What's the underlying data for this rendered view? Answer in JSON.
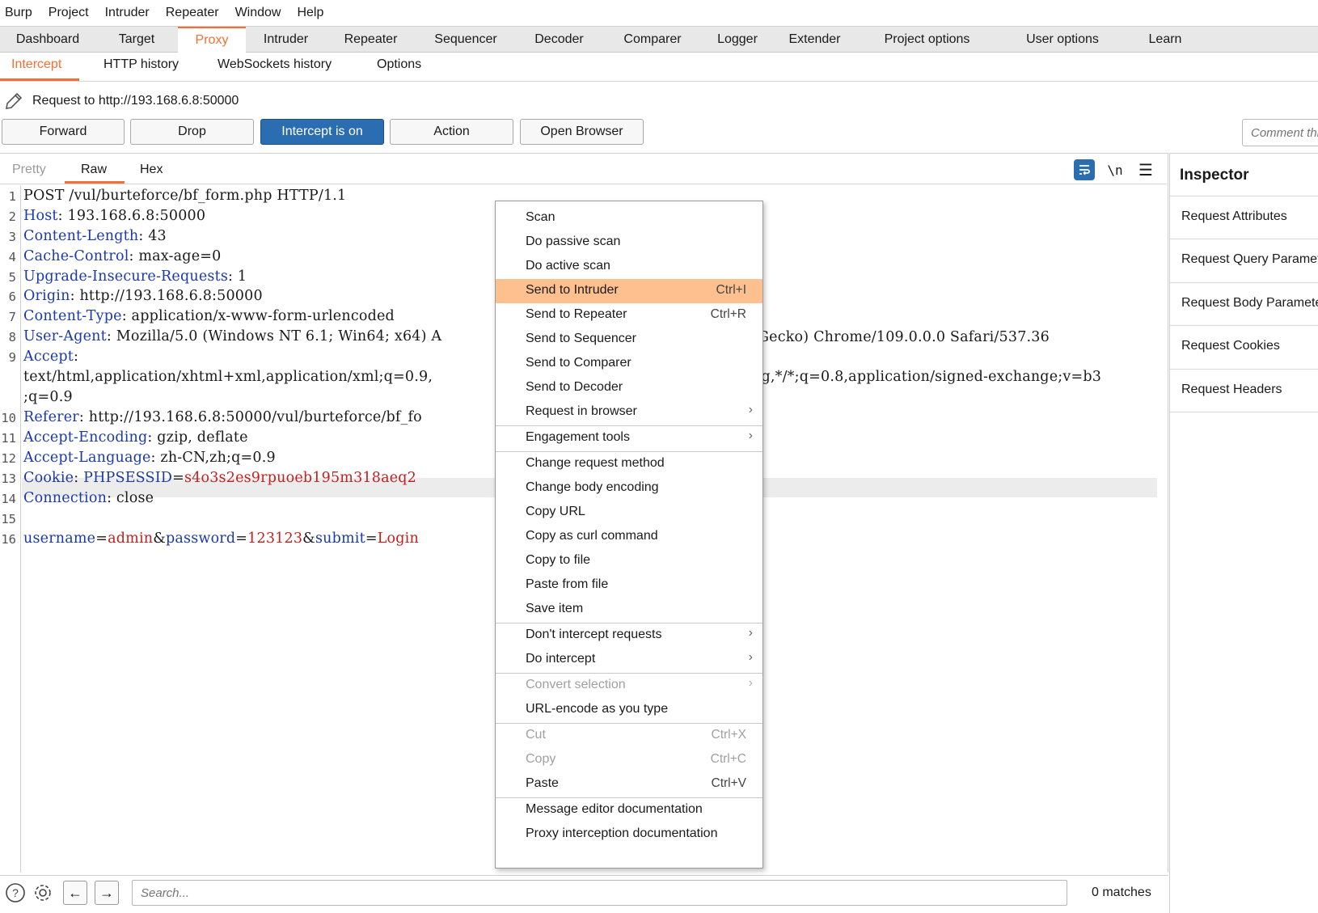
{
  "menubar": [
    "Burp",
    "Project",
    "Intruder",
    "Repeater",
    "Window",
    "Help"
  ],
  "main_tabs": [
    "Dashboard",
    "Target",
    "Proxy",
    "Intruder",
    "Repeater",
    "Sequencer",
    "Decoder",
    "Comparer",
    "Logger",
    "Extender",
    "Project options",
    "User options",
    "Learn"
  ],
  "active_main_tab": "Proxy",
  "sub_tabs": [
    "Intercept",
    "HTTP history",
    "WebSockets history",
    "Options"
  ],
  "active_sub_tab": "Intercept",
  "request_to": "Request to http://193.168.6.8:50000",
  "buttons": {
    "forward": "Forward",
    "drop": "Drop",
    "intercept": "Intercept is on",
    "action": "Action",
    "open_browser": "Open Browser"
  },
  "comment_placeholder": "Comment this item",
  "editor_tabs": [
    "Pretty",
    "Raw",
    "Hex"
  ],
  "active_editor_tab": "Raw",
  "newline_icon_label": "\\n",
  "code_lines": [
    {
      "n": "1",
      "parts": [
        {
          "t": "POST /vul/burteforce/bf_form.php HTTP/1.1",
          "c": ""
        }
      ]
    },
    {
      "n": "2",
      "parts": [
        {
          "t": "Host",
          "c": "k"
        },
        {
          "t": ": 193.168.6.8:50000",
          "c": ""
        }
      ]
    },
    {
      "n": "3",
      "parts": [
        {
          "t": "Content-Length",
          "c": "k"
        },
        {
          "t": ": 43",
          "c": ""
        }
      ]
    },
    {
      "n": "4",
      "parts": [
        {
          "t": "Cache-Control",
          "c": "k"
        },
        {
          "t": ": max-age=0",
          "c": ""
        }
      ]
    },
    {
      "n": "5",
      "parts": [
        {
          "t": "Upgrade-Insecure-Requests",
          "c": "k"
        },
        {
          "t": ": 1",
          "c": ""
        }
      ]
    },
    {
      "n": "6",
      "parts": [
        {
          "t": "Origin",
          "c": "k"
        },
        {
          "t": ": http://193.168.6.8:50000",
          "c": ""
        }
      ]
    },
    {
      "n": "7",
      "parts": [
        {
          "t": "Content-Type",
          "c": "k"
        },
        {
          "t": ": application/x-www-form-urlencoded",
          "c": ""
        }
      ]
    },
    {
      "n": "8",
      "parts": [
        {
          "t": "User-Agent",
          "c": "k"
        },
        {
          "t": ": Mozilla/5.0 (Windows NT 6.1; Win64; x64) A",
          "c": ""
        }
      ]
    },
    {
      "n": "9",
      "parts": [
        {
          "t": "Accept",
          "c": "k"
        },
        {
          "t": ":",
          "c": ""
        }
      ]
    },
    {
      "n": "",
      "parts": [
        {
          "t": "text/html,application/xhtml+xml,application/xml;q=0.9,",
          "c": ""
        }
      ]
    },
    {
      "n": "",
      "parts": [
        {
          "t": ";q=0.9",
          "c": ""
        }
      ]
    },
    {
      "n": "10",
      "parts": [
        {
          "t": "Referer",
          "c": "k"
        },
        {
          "t": ": http://193.168.6.8:50000/vul/burteforce/bf_fo",
          "c": ""
        }
      ]
    },
    {
      "n": "11",
      "parts": [
        {
          "t": "Accept-Encoding",
          "c": "k"
        },
        {
          "t": ": gzip, deflate",
          "c": ""
        }
      ]
    },
    {
      "n": "12",
      "parts": [
        {
          "t": "Accept-Language",
          "c": "k"
        },
        {
          "t": ": zh-CN,zh;q=0.9",
          "c": ""
        }
      ]
    },
    {
      "n": "13",
      "parts": [
        {
          "t": "Cookie",
          "c": "k"
        },
        {
          "t": ": ",
          "c": ""
        },
        {
          "t": "PHPSESSID",
          "c": "k"
        },
        {
          "t": "=",
          "c": ""
        },
        {
          "t": "s4o3s2es9rpuoeb195m318aeq2",
          "c": "v"
        }
      ]
    },
    {
      "n": "14",
      "parts": [
        {
          "t": "Connection",
          "c": "k"
        },
        {
          "t": ": close",
          "c": ""
        }
      ]
    },
    {
      "n": "15",
      "parts": []
    },
    {
      "n": "16",
      "parts": [
        {
          "t": "username",
          "c": "k"
        },
        {
          "t": "=",
          "c": ""
        },
        {
          "t": "admin",
          "c": "v"
        },
        {
          "t": "&",
          "c": ""
        },
        {
          "t": "password",
          "c": "k"
        },
        {
          "t": "=",
          "c": ""
        },
        {
          "t": "123123",
          "c": "v"
        },
        {
          "t": "&",
          "c": ""
        },
        {
          "t": "submit",
          "c": "k"
        },
        {
          "t": "=",
          "c": ""
        },
        {
          "t": "Login",
          "c": "v"
        }
      ]
    }
  ],
  "overflow_text": {
    "line8_tail": "Gecko) Chrome/109.0.0.0 Safari/537.36",
    "line9_tail": "ng,*/*;q=0.8,application/signed-exchange;v=b3"
  },
  "context_menu": [
    {
      "label": "Scan"
    },
    {
      "label": "Do passive scan"
    },
    {
      "label": "Do active scan"
    },
    {
      "label": "Send to Intruder",
      "shortcut": "Ctrl+I",
      "highlight": true
    },
    {
      "label": "Send to Repeater",
      "shortcut": "Ctrl+R"
    },
    {
      "label": "Send to Sequencer"
    },
    {
      "label": "Send to Comparer"
    },
    {
      "label": "Send to Decoder"
    },
    {
      "label": "Request in browser",
      "submenu": true
    },
    {
      "sep": true
    },
    {
      "label": "Engagement tools",
      "submenu": true
    },
    {
      "sep": true
    },
    {
      "label": "Change request method"
    },
    {
      "label": "Change body encoding"
    },
    {
      "label": "Copy URL"
    },
    {
      "label": "Copy as curl command"
    },
    {
      "label": "Copy to file"
    },
    {
      "label": "Paste from file"
    },
    {
      "label": "Save item"
    },
    {
      "sep": true
    },
    {
      "label": "Don't intercept requests",
      "submenu": true
    },
    {
      "label": "Do intercept",
      "submenu": true
    },
    {
      "sep": true
    },
    {
      "label": "Convert selection",
      "submenu": true,
      "disabled": true
    },
    {
      "label": "URL-encode as you type"
    },
    {
      "sep": true
    },
    {
      "label": "Cut",
      "shortcut": "Ctrl+X",
      "disabled": true
    },
    {
      "label": "Copy",
      "shortcut": "Ctrl+C",
      "disabled": true
    },
    {
      "label": "Paste",
      "shortcut": "Ctrl+V"
    },
    {
      "sep": true
    },
    {
      "label": "Message editor documentation"
    },
    {
      "label": "Proxy interception documentation"
    }
  ],
  "inspector": {
    "title": "Inspector",
    "items": [
      "Request Attributes",
      "Request Query Parameters",
      "Request Body Parameters",
      "Request Cookies",
      "Request Headers"
    ]
  },
  "search": {
    "placeholder": "Search...",
    "matches": "0 matches"
  },
  "colors": {
    "accent": "#f36f34",
    "button_on": "#2b6db1",
    "menu_highlight": "#ffc08f",
    "key": "#1b3aa8",
    "value": "#c0211f"
  }
}
